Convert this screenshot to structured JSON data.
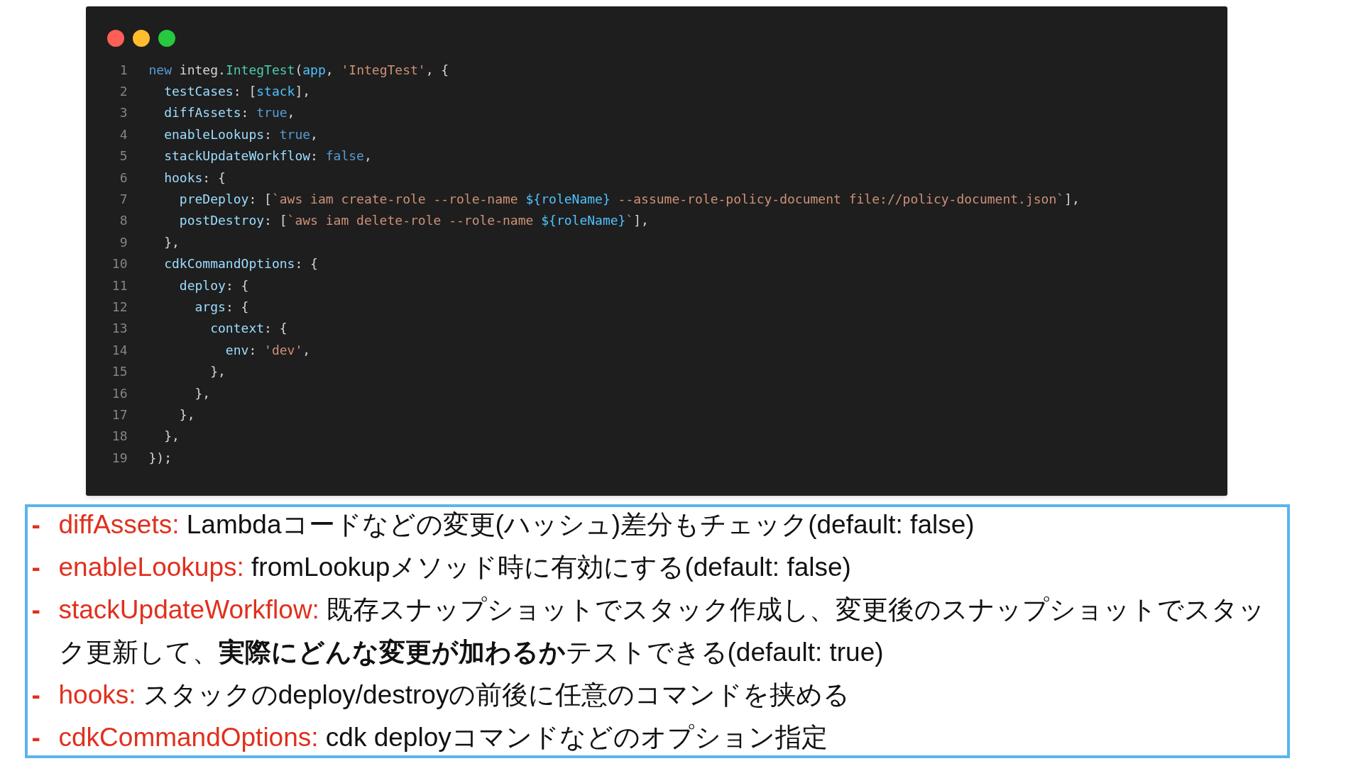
{
  "code_window": {
    "lines": [
      {
        "number": "1",
        "tokens": [
          {
            "t": "new",
            "kind": "keyword"
          },
          {
            "t": " integ.",
            "kind": "var"
          },
          {
            "t": "IntegTest",
            "kind": "class"
          },
          {
            "t": "(",
            "kind": "punct"
          },
          {
            "t": "app",
            "kind": "const"
          },
          {
            "t": ", ",
            "kind": "punct"
          },
          {
            "t": "'IntegTest'",
            "kind": "string"
          },
          {
            "t": ", {",
            "kind": "punct"
          }
        ]
      },
      {
        "number": "2",
        "tokens": [
          {
            "t": "  testCases",
            "kind": "prop"
          },
          {
            "t": ": [",
            "kind": "punct"
          },
          {
            "t": "stack",
            "kind": "const"
          },
          {
            "t": "],",
            "kind": "punct"
          }
        ]
      },
      {
        "number": "3",
        "tokens": [
          {
            "t": "  diffAssets",
            "kind": "prop"
          },
          {
            "t": ": ",
            "kind": "punct"
          },
          {
            "t": "true",
            "kind": "keyword"
          },
          {
            "t": ",",
            "kind": "punct"
          }
        ]
      },
      {
        "number": "4",
        "tokens": [
          {
            "t": "  enableLookups",
            "kind": "prop"
          },
          {
            "t": ": ",
            "kind": "punct"
          },
          {
            "t": "true",
            "kind": "keyword"
          },
          {
            "t": ",",
            "kind": "punct"
          }
        ]
      },
      {
        "number": "5",
        "tokens": [
          {
            "t": "  stackUpdateWorkflow",
            "kind": "prop"
          },
          {
            "t": ": ",
            "kind": "punct"
          },
          {
            "t": "false",
            "kind": "keyword"
          },
          {
            "t": ",",
            "kind": "punct"
          }
        ]
      },
      {
        "number": "6",
        "tokens": [
          {
            "t": "  hooks",
            "kind": "prop"
          },
          {
            "t": ": {",
            "kind": "punct"
          }
        ]
      },
      {
        "number": "7",
        "tokens": [
          {
            "t": "    preDeploy",
            "kind": "prop"
          },
          {
            "t": ": [",
            "kind": "punct"
          },
          {
            "t": "`aws iam create-role --role-name ",
            "kind": "string"
          },
          {
            "t": "${roleName}",
            "kind": "const"
          },
          {
            "t": " --assume-role-policy-document file://policy-document.json`",
            "kind": "string"
          },
          {
            "t": "],",
            "kind": "punct"
          }
        ]
      },
      {
        "number": "8",
        "tokens": [
          {
            "t": "    postDestroy",
            "kind": "prop"
          },
          {
            "t": ": [",
            "kind": "punct"
          },
          {
            "t": "`aws iam delete-role --role-name ",
            "kind": "string"
          },
          {
            "t": "${roleName}",
            "kind": "const"
          },
          {
            "t": "`",
            "kind": "string"
          },
          {
            "t": "],",
            "kind": "punct"
          }
        ]
      },
      {
        "number": "9",
        "tokens": [
          {
            "t": "  },",
            "kind": "punct"
          }
        ]
      },
      {
        "number": "10",
        "tokens": [
          {
            "t": "  cdkCommandOptions",
            "kind": "prop"
          },
          {
            "t": ": {",
            "kind": "punct"
          }
        ]
      },
      {
        "number": "11",
        "tokens": [
          {
            "t": "    deploy",
            "kind": "prop"
          },
          {
            "t": ": {",
            "kind": "punct"
          }
        ]
      },
      {
        "number": "12",
        "tokens": [
          {
            "t": "      args",
            "kind": "prop"
          },
          {
            "t": ": {",
            "kind": "punct"
          }
        ]
      },
      {
        "number": "13",
        "tokens": [
          {
            "t": "        context",
            "kind": "prop"
          },
          {
            "t": ": {",
            "kind": "punct"
          }
        ]
      },
      {
        "number": "14",
        "tokens": [
          {
            "t": "          env",
            "kind": "prop"
          },
          {
            "t": ": ",
            "kind": "punct"
          },
          {
            "t": "'dev'",
            "kind": "string"
          },
          {
            "t": ",",
            "kind": "punct"
          }
        ]
      },
      {
        "number": "15",
        "tokens": [
          {
            "t": "        },",
            "kind": "punct"
          }
        ]
      },
      {
        "number": "16",
        "tokens": [
          {
            "t": "      },",
            "kind": "punct"
          }
        ]
      },
      {
        "number": "17",
        "tokens": [
          {
            "t": "    },",
            "kind": "punct"
          }
        ]
      },
      {
        "number": "18",
        "tokens": [
          {
            "t": "  },",
            "kind": "punct"
          }
        ]
      },
      {
        "number": "19",
        "tokens": [
          {
            "t": "});",
            "kind": "punct"
          }
        ]
      }
    ]
  },
  "notes": [
    {
      "marker": "-",
      "label": "diffAssets:",
      "text": "Lambdaコードなどの変更(ハッシュ)差分もチェック(default: false)"
    },
    {
      "marker": "-",
      "label": "enableLookups:",
      "text": "fromLookupメソッド時に有効にする(default: false)"
    },
    {
      "marker": "-",
      "label": "stackUpdateWorkflow:",
      "text": "既存スナップショットでスタック作成し、変更後のスナップショットでスタック更新して、**実際にどんな変更が加わるか**テストできる(default: true)"
    },
    {
      "marker": "-",
      "label": "hooks:",
      "text": "スタックのdeploy/destroyの前後に任意のコマンドを挟める"
    },
    {
      "marker": "-",
      "label": "cdkCommandOptions:",
      "text": "cdk deployコマンドなどのオプション指定"
    }
  ]
}
